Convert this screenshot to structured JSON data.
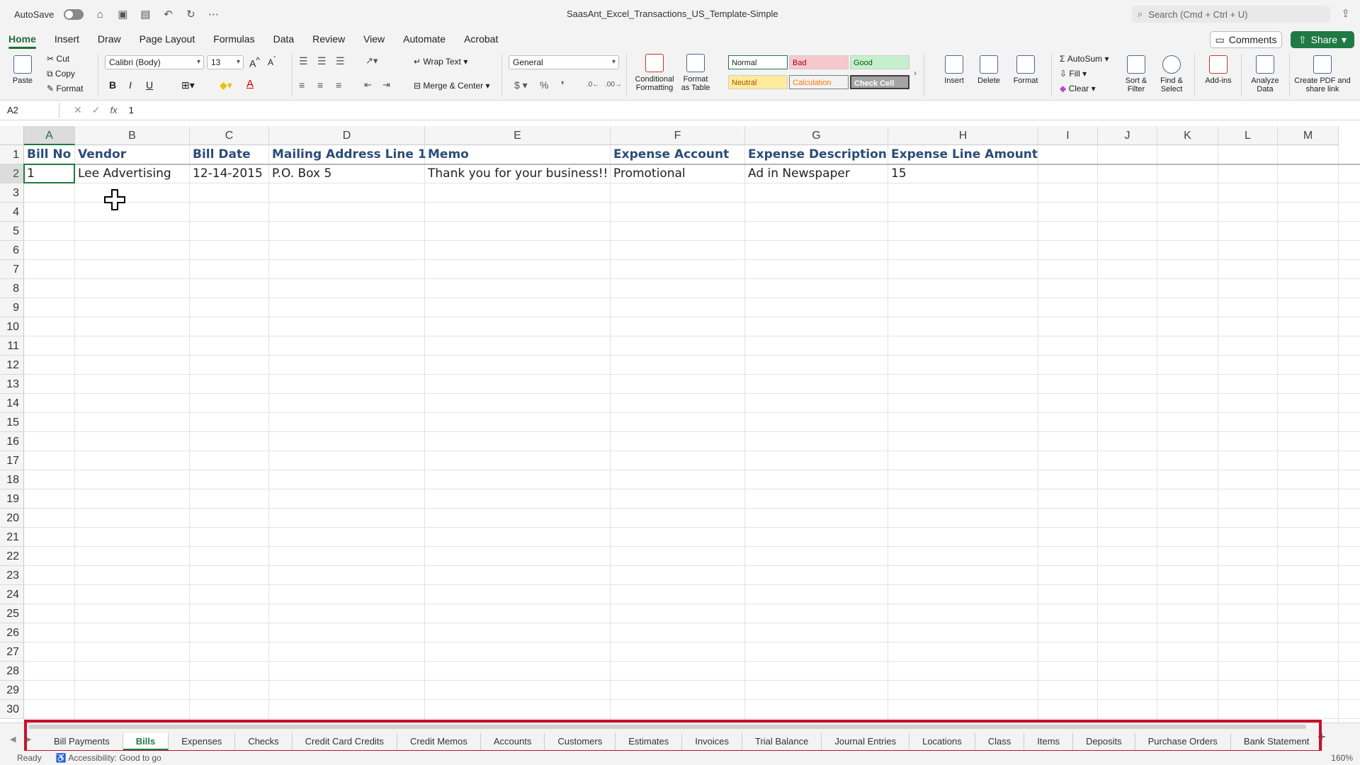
{
  "titlebar": {
    "autosave_label": "AutoSave",
    "document_title": "SaasAnt_Excel_Transactions_US_Template-Simple",
    "search_placeholder": "Search (Cmd + Ctrl + U)"
  },
  "menu": {
    "tabs": [
      "Home",
      "Insert",
      "Draw",
      "Page Layout",
      "Formulas",
      "Data",
      "Review",
      "View",
      "Automate",
      "Acrobat"
    ],
    "active": "Home",
    "comments_label": "Comments",
    "share_label": "Share"
  },
  "ribbon": {
    "paste": "Paste",
    "cut": "Cut",
    "copy": "Copy",
    "format_painter": "Format",
    "font_name": "Calibri (Body)",
    "font_size": "13",
    "bold": "B",
    "italic": "I",
    "underline": "U",
    "wrap_text": "Wrap Text",
    "merge_center": "Merge & Center",
    "number_format": "General",
    "conditional_formatting": "Conditional Formatting",
    "format_as_table": "Format as Table",
    "styles": {
      "normal": "Normal",
      "bad": "Bad",
      "good": "Good",
      "neutral": "Neutral",
      "calculation": "Calculation",
      "check_cell": "Check Cell"
    },
    "insert": "Insert",
    "delete": "Delete",
    "format": "Format",
    "autosum": "AutoSum",
    "fill": "Fill",
    "clear": "Clear",
    "sort_filter": "Sort & Filter",
    "find_select": "Find & Select",
    "addins": "Add-ins",
    "analyze_data": "Analyze Data",
    "create_pdf": "Create PDF and share link"
  },
  "formula_bar": {
    "name_box": "A2",
    "fx": "fx",
    "value": "1"
  },
  "grid": {
    "columns": [
      "A",
      "B",
      "C",
      "D",
      "E",
      "F",
      "G",
      "H",
      "I",
      "J",
      "K",
      "L",
      "M"
    ],
    "rows": [
      "1",
      "2",
      "3",
      "4",
      "5",
      "6",
      "7",
      "8",
      "9",
      "10",
      "11",
      "12",
      "13",
      "14",
      "15",
      "16",
      "17",
      "18",
      "19",
      "20",
      "21",
      "22",
      "23",
      "24",
      "25",
      "26",
      "27",
      "28",
      "29",
      "30"
    ],
    "header_row": [
      "Bill No",
      "Vendor",
      "Bill Date",
      "Mailing Address Line 1",
      "Memo",
      "Expense Account",
      "Expense Description",
      "Expense Line Amount"
    ],
    "data_row": [
      "1",
      "Lee Advertising",
      "12-14-2015",
      "P.O. Box 5",
      "Thank you for your business!!",
      "Promotional",
      "Ad in Newspaper",
      "15"
    ],
    "active_cell": "A2"
  },
  "sheets": {
    "tabs": [
      "Bill Payments",
      "Bills",
      "Expenses",
      "Checks",
      "Credit Card Credits",
      "Credit Memos",
      "Accounts",
      "Customers",
      "Estimates",
      "Invoices",
      "Trial Balance",
      "Journal Entries",
      "Locations",
      "Class",
      "Items",
      "Deposits",
      "Purchase Orders",
      "Bank Statement"
    ],
    "active": "Bills",
    "highlight_color": "#c8102e"
  },
  "status": {
    "ready": "Ready",
    "accessibility": "Accessibility: Good to go",
    "zoom": "160%"
  }
}
